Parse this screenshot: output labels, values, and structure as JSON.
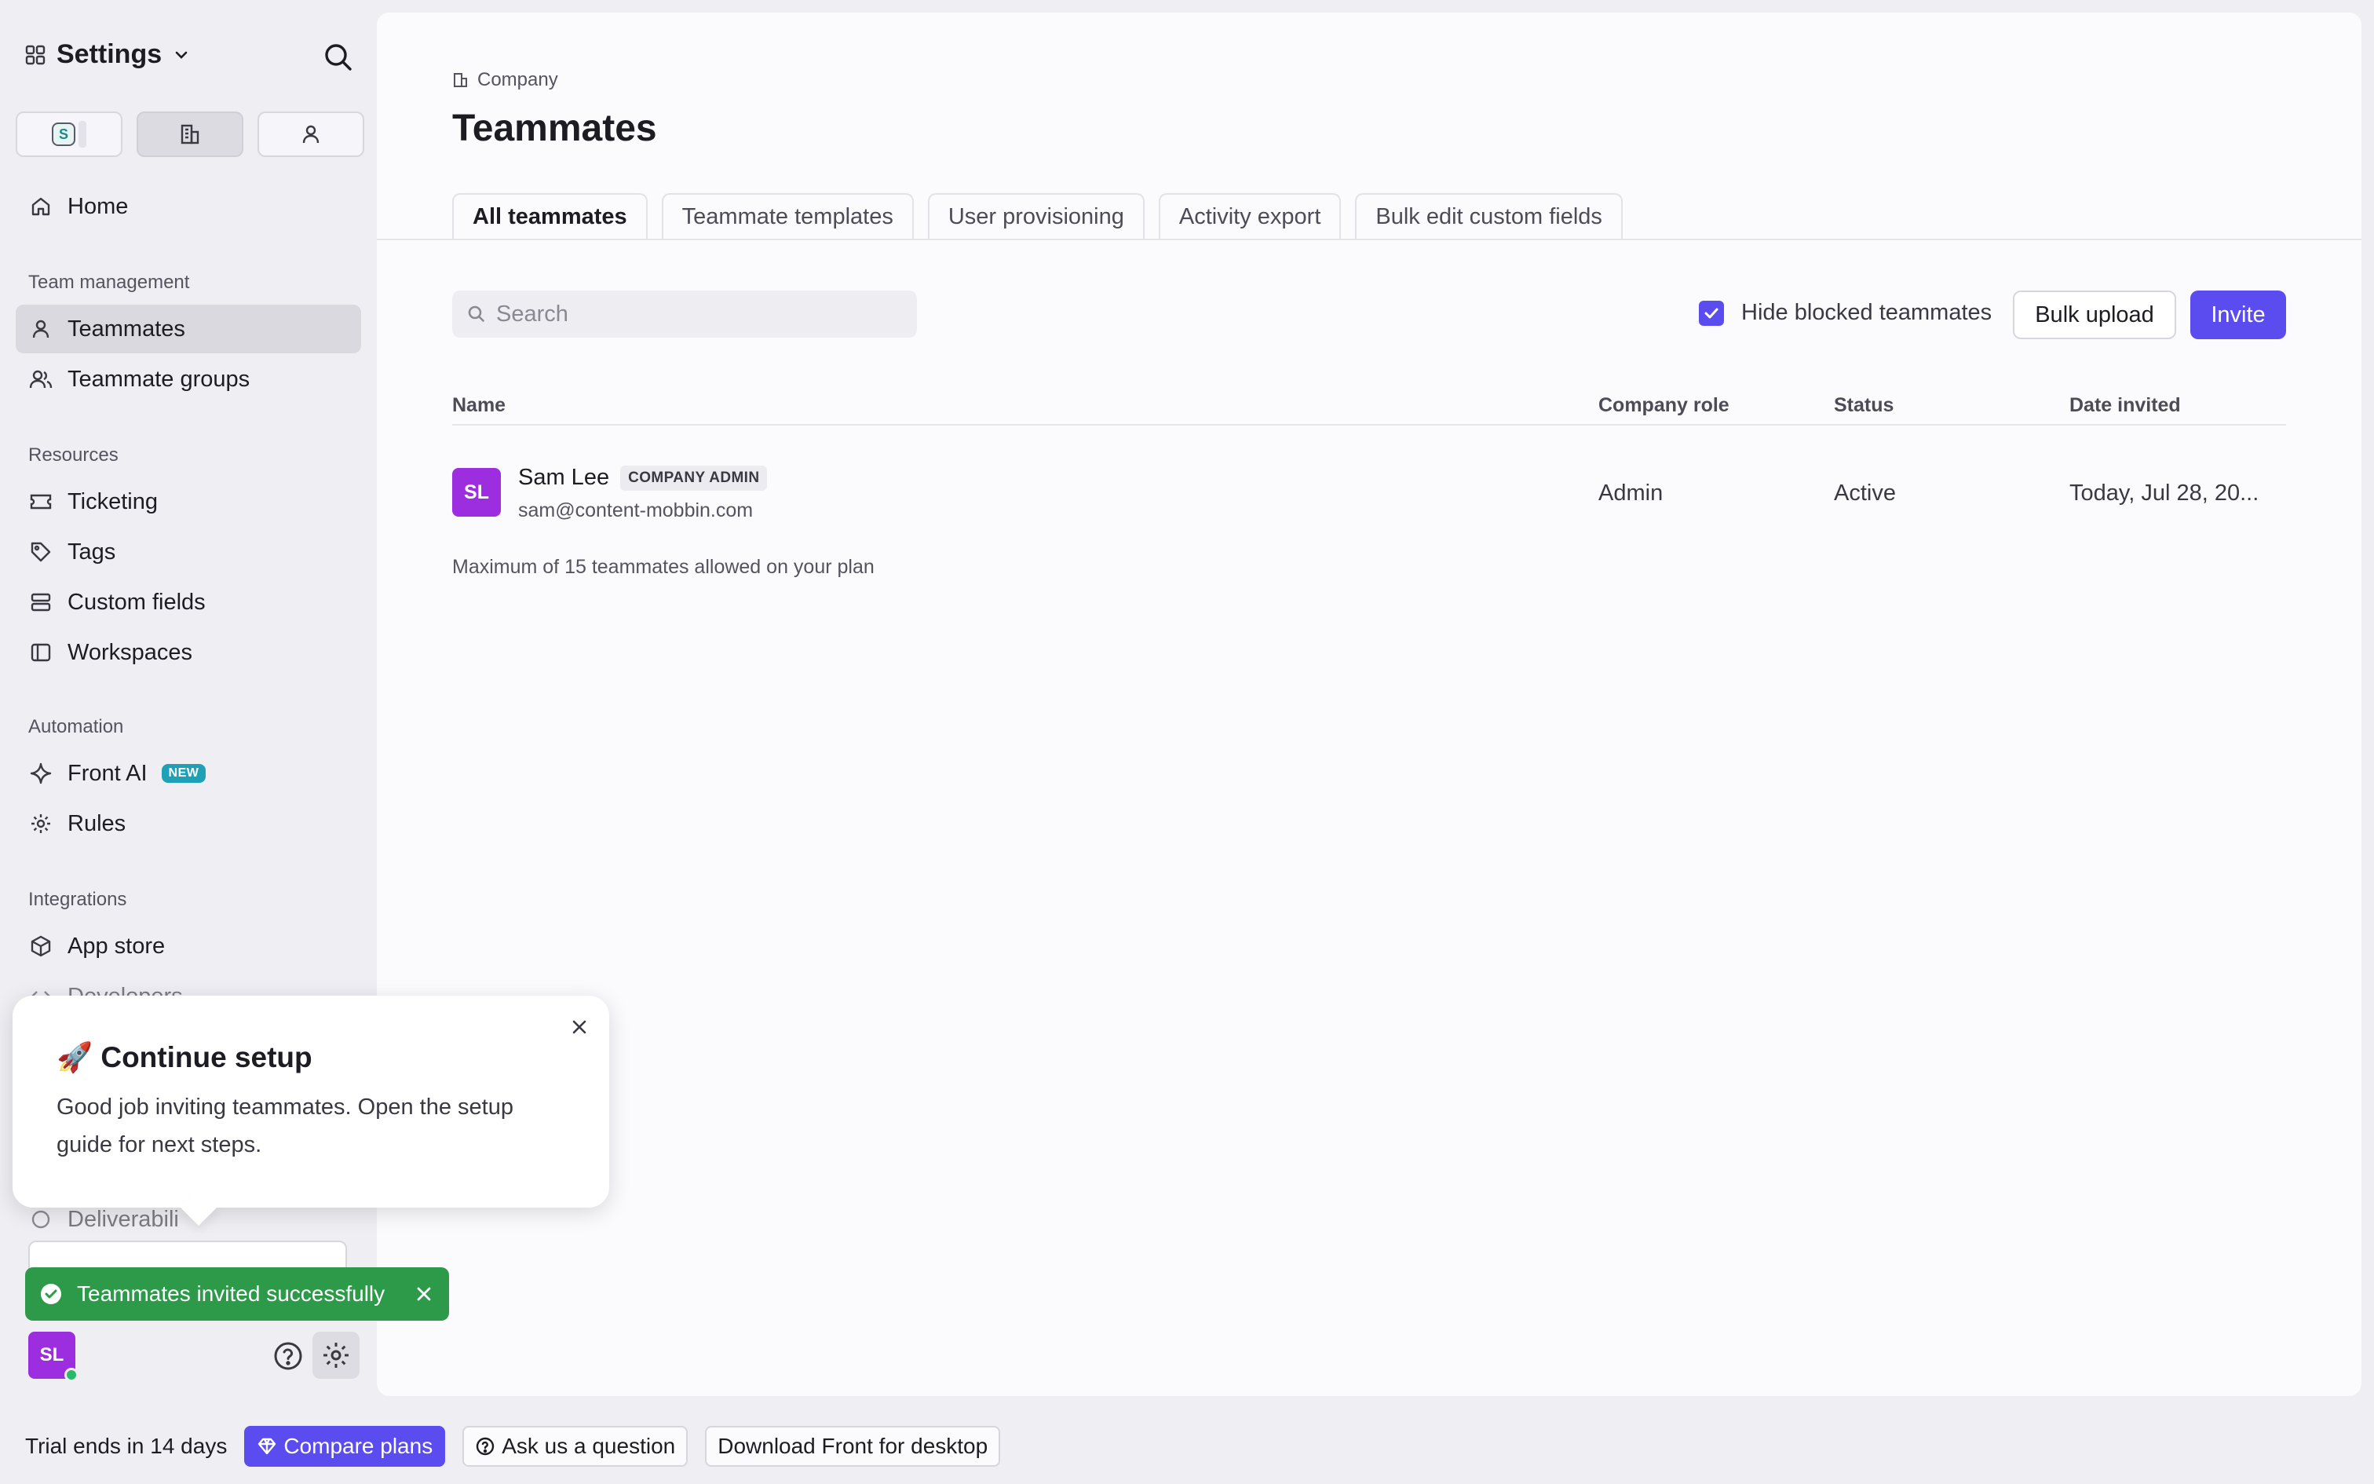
{
  "sidebar": {
    "title": "Settings",
    "home": "Home",
    "sections": {
      "team_management": "Team management",
      "resources": "Resources",
      "automation": "Automation",
      "integrations": "Integrations"
    },
    "items": {
      "teammates": "Teammates",
      "teammate_groups": "Teammate groups",
      "ticketing": "Ticketing",
      "tags": "Tags",
      "custom_fields": "Custom fields",
      "workspaces": "Workspaces",
      "front_ai": "Front AI",
      "front_ai_badge": "NEW",
      "rules": "Rules",
      "app_store": "App store",
      "developers": "Developers",
      "deliverability": "Deliverabili"
    },
    "scope_s": "S",
    "user_initials": "SL"
  },
  "main": {
    "breadcrumb": "Company",
    "title": "Teammates",
    "tabs": [
      "All teammates",
      "Teammate templates",
      "User provisioning",
      "Activity export",
      "Bulk edit custom fields"
    ],
    "search_placeholder": "Search",
    "hide_blocked_label": "Hide blocked teammates",
    "bulk_upload": "Bulk upload",
    "invite": "Invite",
    "columns": [
      "Name",
      "Company role",
      "Status",
      "Date invited"
    ],
    "rows": [
      {
        "initials": "SL",
        "name": "Sam Lee",
        "badge": "COMPANY ADMIN",
        "email": "sam@content-mobbin.com",
        "role": "Admin",
        "status": "Active",
        "date_invited": "Today, Jul 28, 20..."
      }
    ],
    "plan_note": "Maximum of 15 teammates allowed on your plan"
  },
  "popover": {
    "emoji": "🚀",
    "title": "Continue setup",
    "body": "Good job inviting teammates. Open the setup guide for next steps."
  },
  "toast": {
    "message": "Teammates invited successfully"
  },
  "bottom_bar": {
    "trial": "Trial ends in 14 days",
    "compare_plans": "Compare plans",
    "ask": "Ask us a question",
    "download": "Download Front for desktop"
  },
  "colors": {
    "accent": "#5b4cf0",
    "avatar": "#9c2ee0",
    "toast": "#2d9a4a",
    "new_badge": "#1ea0b7"
  }
}
